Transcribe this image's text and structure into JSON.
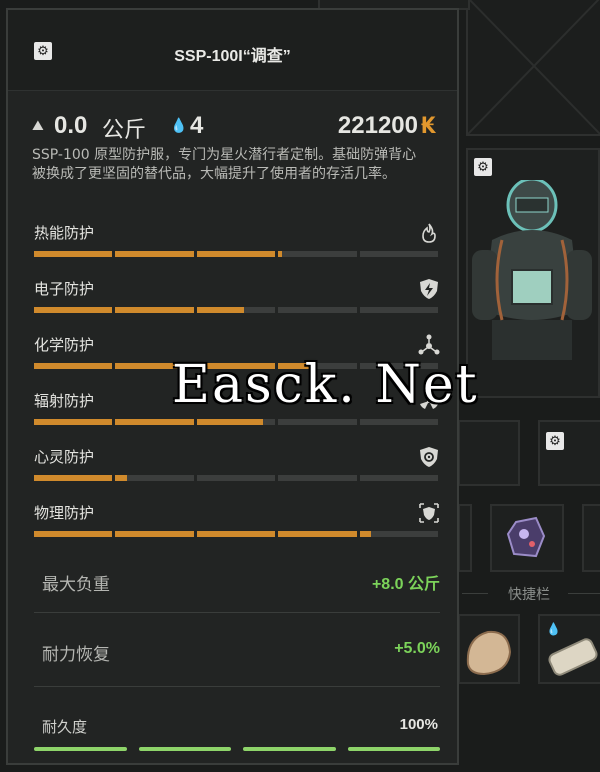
{
  "item": {
    "title": "SSP-100I“调查”",
    "weight_value": "0.0",
    "weight_unit": "公斤",
    "slots": "4",
    "price": "221200",
    "currency_symbol": "₭",
    "description": "SSP-100 原型防护服，专门为星火潜行者定制。基础防弹背心被换成了更坚固的替代品，大幅提升了使用者的存活几率。"
  },
  "protections": [
    {
      "label": "热能防护",
      "icon": "flame-icon",
      "fill": 0.61
    },
    {
      "label": "电子防护",
      "icon": "lightning-shield-icon",
      "fill": 0.52
    },
    {
      "label": "化学防护",
      "icon": "chemical-icon",
      "fill": 0.7
    },
    {
      "label": "辐射防护",
      "icon": "radiation-icon",
      "fill": 0.57
    },
    {
      "label": "心灵防护",
      "icon": "psy-shield-icon",
      "fill": 0.23
    },
    {
      "label": "物理防护",
      "icon": "armor-icon",
      "fill": 0.83
    }
  ],
  "attributes": [
    {
      "label": "最大负重",
      "value": "+8.0 公斤"
    },
    {
      "label": "耐力恢复",
      "value": "+5.0%"
    }
  ],
  "durability": {
    "label": "耐久度",
    "value": "100%"
  },
  "inventory": {
    "quickbar_label": "快捷栏"
  },
  "watermark": "Easck. Net",
  "colors": {
    "bar_fill": "#d08a2c",
    "bar_empty": "#3c3e3d",
    "positive": "#7cd35a",
    "currency": "#e2982e",
    "durability": "#8ed46a"
  }
}
